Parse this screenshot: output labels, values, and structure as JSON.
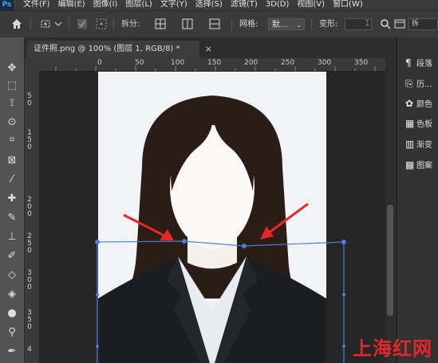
{
  "menubar": {
    "logo": "Ps",
    "items": [
      "文件(F)",
      "编辑(E)",
      "图像(I)",
      "图层(L)",
      "文字(Y)",
      "选择(S)",
      "滤镜(T)",
      "3D(D)",
      "视图(V)",
      "窗口(W)"
    ]
  },
  "options": {
    "split_label": "拆分:",
    "grid_label": "网格:",
    "grid_value": "默...",
    "warp_label": "变形:",
    "warp_value": "",
    "expand_label": "拆"
  },
  "document": {
    "tab_title": "证件照.png @ 100% (图层 1, RGB/8) *",
    "close": "×"
  },
  "ruler_h": {
    "labels": [
      "0",
      "50",
      "100",
      "150",
      "200",
      "250",
      "300",
      "350"
    ]
  },
  "ruler_v": {
    "labels": [
      "5",
      "0",
      "1",
      "5",
      "0",
      "2",
      "0",
      "0",
      "2",
      "5",
      "0",
      "3",
      "0",
      "0",
      "3",
      "5",
      "0",
      "4"
    ]
  },
  "panels": {
    "items": [
      {
        "icon": "paragraph-icon",
        "label": "段落"
      },
      {
        "icon": "history-icon",
        "label": "历..."
      },
      {
        "icon": "palette-icon",
        "label": "颜色"
      },
      {
        "icon": "swatches-icon",
        "label": "色板"
      },
      {
        "icon": "gradient-icon",
        "label": "渐变"
      },
      {
        "icon": "patterns-icon",
        "label": "图案"
      }
    ]
  },
  "watermark": "上海红网",
  "colors": {
    "warp_line": "#4a7fd6",
    "arrow": "#e8262a",
    "suit": "#1c1d22",
    "shirt": "#e9ebf0",
    "hair": "#2a1d16",
    "background": "#f2f3f7"
  }
}
